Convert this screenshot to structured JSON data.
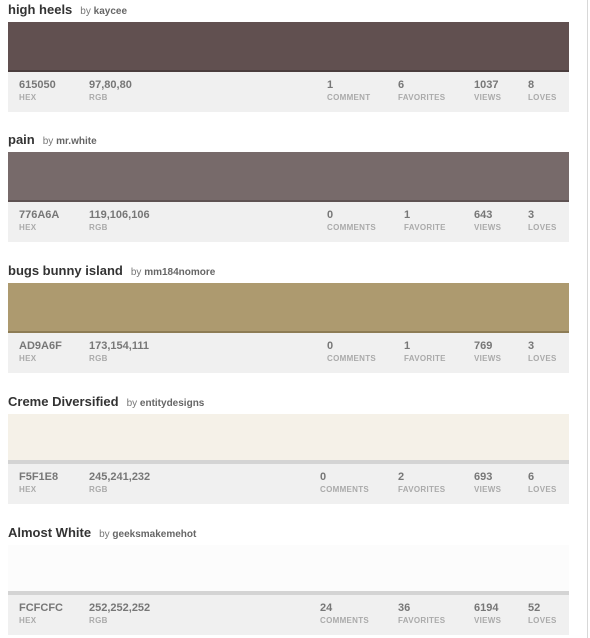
{
  "palettes": [
    {
      "title": "high heels",
      "by_word": "by",
      "author": "kaycee",
      "color": "#615050",
      "hex": "615050",
      "hex_label": "HEX",
      "rgb": "97,80,80",
      "rgb_label": "RGB",
      "comments": "1",
      "comments_label": "COMMENT",
      "favorites": "6",
      "favorites_label": "FAVORITES",
      "views": "1037",
      "views_label": "VIEWS",
      "loves": "8",
      "loves_label": "LOVES"
    },
    {
      "title": "pain",
      "by_word": "by",
      "author": "mr.white",
      "color": "#776A6A",
      "hex": "776A6A",
      "hex_label": "HEX",
      "rgb": "119,106,106",
      "rgb_label": "RGB",
      "comments": "0",
      "comments_label": "COMMENTS",
      "favorites": "1",
      "favorites_label": "FAVORITE",
      "views": "643",
      "views_label": "VIEWS",
      "loves": "3",
      "loves_label": "LOVES"
    },
    {
      "title": "bugs bunny island",
      "by_word": "by",
      "author": "mm184nomore",
      "color": "#AD9A6F",
      "hex": "AD9A6F",
      "hex_label": "HEX",
      "rgb": "173,154,111",
      "rgb_label": "RGB",
      "comments": "0",
      "comments_label": "COMMENTS",
      "favorites": "1",
      "favorites_label": "FAVORITE",
      "views": "769",
      "views_label": "VIEWS",
      "loves": "3",
      "loves_label": "LOVES"
    },
    {
      "title": "Creme Diversified",
      "by_word": "by",
      "author": "entitydesigns",
      "color": "#F5F1E8",
      "hex": "F5F1E8",
      "hex_label": "HEX",
      "rgb": "245,241,232",
      "rgb_label": "RGB",
      "comments": "0",
      "comments_label": "COMMENTS",
      "favorites": "2",
      "favorites_label": "FAVORITES",
      "views": "693",
      "views_label": "VIEWS",
      "loves": "6",
      "loves_label": "LOVES"
    },
    {
      "title": "Almost White",
      "by_word": "by",
      "author": "geeksmakemehot",
      "color": "#FCFCFC",
      "hex": "FCFCFC",
      "hex_label": "HEX",
      "rgb": "252,252,252",
      "rgb_label": "RGB",
      "comments": "24",
      "comments_label": "COMMENTS",
      "favorites": "36",
      "favorites_label": "FAVORITES",
      "views": "6194",
      "views_label": "VIEWS",
      "loves": "52",
      "loves_label": "LOVES"
    }
  ]
}
